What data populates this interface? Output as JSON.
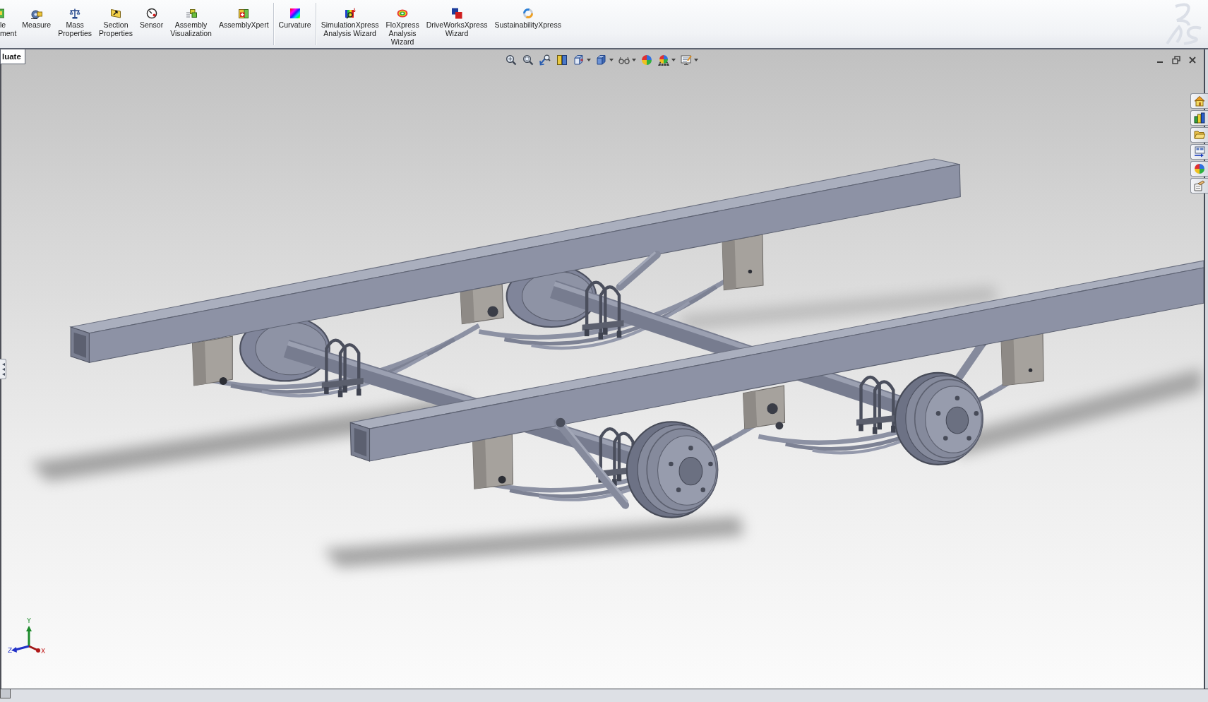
{
  "command_manager": {
    "groups": [
      [
        {
          "label": "le\nment",
          "kind": "partial"
        },
        {
          "label": "Measure",
          "kind": "tool"
        },
        {
          "label": "Mass\nProperties",
          "kind": "tool"
        },
        {
          "label": "Section\nProperties",
          "kind": "tool"
        },
        {
          "label": "Sensor",
          "kind": "tool"
        },
        {
          "label": "Assembly\nVisualization",
          "kind": "tool"
        },
        {
          "label": "AssemblyXpert",
          "kind": "tool"
        }
      ],
      [
        {
          "label": "Curvature",
          "kind": "tool"
        }
      ],
      [
        {
          "label": "SimulationXpress\nAnalysis Wizard",
          "kind": "tool"
        },
        {
          "label": "FloXpress\nAnalysis\nWizard",
          "kind": "tool"
        },
        {
          "label": "DriveWorksXpress\nWizard",
          "kind": "tool"
        },
        {
          "label": "SustainabilityXpress",
          "kind": "tool"
        }
      ]
    ]
  },
  "tabs": [
    {
      "label": "luate",
      "selected": true
    }
  ],
  "triad": {
    "y_label": "Y",
    "z_label": "Z",
    "x_label": "X"
  }
}
